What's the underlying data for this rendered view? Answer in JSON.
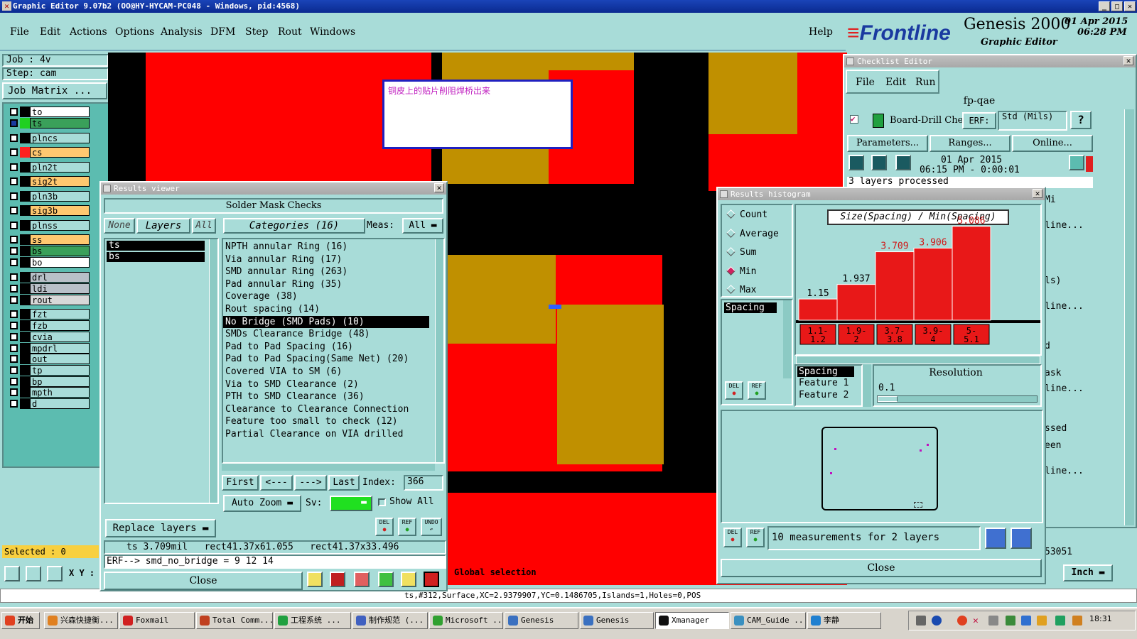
{
  "window": {
    "title": "Graphic Editor 9.07b2 (OO@HY-HYCAM-PC048 - Windows, pid:4568)"
  },
  "menu": {
    "file": "File",
    "edit": "Edit",
    "actions": "Actions",
    "options": "Options",
    "analysis": "Analysis",
    "dfm": "DFM",
    "step": "Step",
    "rout": "Rout",
    "windows": "Windows",
    "help": "Help"
  },
  "brand": {
    "logo": "Frontline",
    "product": "Genesis 2000",
    "sub": "Graphic Editor",
    "date": "01 Apr 2015",
    "time": "06:28 PM"
  },
  "job": {
    "job": "Job : 4v",
    "step": "Step: cam",
    "matrix": "Job Matrix ..."
  },
  "layers": [
    {
      "name": "to",
      "color": "#ffffff"
    },
    {
      "name": "ts",
      "color": "#3aa05a"
    },
    {
      "name": "plncs",
      "color": "#a8dcd8"
    },
    {
      "name": "cs",
      "color": "#ffc870"
    },
    {
      "name": "pln2t",
      "color": "#a8dcd8"
    },
    {
      "name": "sig2t",
      "color": "#ffc870"
    },
    {
      "name": "pln3b",
      "color": "#a8dcd8"
    },
    {
      "name": "sig3b",
      "color": "#ffc870"
    },
    {
      "name": "plnss",
      "color": "#a8dcd8"
    },
    {
      "name": "ss",
      "color": "#ffc870"
    },
    {
      "name": "bs",
      "color": "#3aa05a"
    },
    {
      "name": "bo",
      "color": "#ffffff"
    },
    {
      "name": "drl",
      "color": "#b8c0c8"
    },
    {
      "name": "ldi",
      "color": "#b8c0c8"
    },
    {
      "name": "rout",
      "color": "#d8d8d8"
    },
    {
      "name": "fzt",
      "color": "#a8dcd8"
    },
    {
      "name": "fzb",
      "color": "#a8dcd8"
    },
    {
      "name": "cvia",
      "color": "#a8dcd8"
    },
    {
      "name": "mpdrl",
      "color": "#a8dcd8"
    },
    {
      "name": "out",
      "color": "#a8dcd8"
    },
    {
      "name": "tp",
      "color": "#a8dcd8"
    },
    {
      "name": "bp",
      "color": "#a8dcd8"
    },
    {
      "name": "mpth",
      "color": "#a8dcd8"
    },
    {
      "name": "d",
      "color": "#a8dcd8"
    }
  ],
  "selected": "Selected : 0",
  "xy_label": "X Y :",
  "note": "铜皮上的贴片削阻焊桥出来",
  "status_line": "ts,#312,Surface,XC=2.9379907,YC=0.1486705,Islands=1,Holes=0,POS",
  "global_selection": "Global selection",
  "units": "Inch",
  "results_viewer": {
    "title": "Results viewer",
    "header": "Solder Mask Checks",
    "none": "None",
    "layers": "Layers",
    "all": "All",
    "categories": "Categories (16)",
    "meas_label": "Meas:",
    "meas_value": "All",
    "layer_list": [
      "ts",
      "bs"
    ],
    "category_list": [
      "NPTH annular Ring (16)",
      "Via annular Ring (17)",
      "SMD annular Ring (263)",
      "Pad annular Ring (35)",
      "Coverage (38)",
      "Rout spacing (14)",
      "No Bridge (SMD Pads) (10)",
      "SMDs Clearance Bridge (48)",
      "Pad to Pad Spacing (16)",
      "Pad to Pad Spacing(Same Net) (20)",
      "Covered VIA to SM (6)",
      "Via to SMD Clearance (2)",
      "PTH to SMD Clearance (36)",
      "Clearance to Clearance Connection",
      "Feature too small to check (12)",
      "Partial Clearance on VIA drilled"
    ],
    "selected_index": 6,
    "first": "First",
    "prev": "<---",
    "next": "--->",
    "last": "Last",
    "index_label": "Index:",
    "index_value": "366",
    "auto_zoom": "Auto Zoom",
    "sv": "Sv:",
    "show_all": "Show All",
    "replace_layers": "Replace layers",
    "del": "DEL",
    "ref": "REF",
    "undo": "UNDO",
    "info1": "ts 3.709mil   rect41.37x61.055   rect41.37x33.496",
    "erf": "ERF--> smd_no_bridge = 9 12 14",
    "close": "Close"
  },
  "histogram": {
    "title": "Results histogram",
    "modes": [
      "Count",
      "Average",
      "Sum",
      "Min",
      "Max"
    ],
    "selected_mode": "Min",
    "list_item": "Spacing",
    "chart_title": "Size(Spacing) / Min(Spacing)",
    "resolution_label": "Resolution",
    "resolution_value": "0.1",
    "measure_list": [
      "Spacing",
      "Feature 1",
      "Feature 2"
    ],
    "del": "DEL",
    "ref": "REF",
    "footer": "10 measurements for 2 layers",
    "close": "Close"
  },
  "chart_data": {
    "type": "bar",
    "title": "Size(Spacing) / Min(Spacing)",
    "categories": [
      "1.1-1.2",
      "1.9-2",
      "3.7-3.8",
      "3.9-4",
      "5-5.1"
    ],
    "values": [
      1.15,
      1.937,
      3.709,
      3.906,
      5.086
    ],
    "value_labels": [
      "1.15",
      "1.937",
      "3.709",
      "3.906",
      "5.086"
    ],
    "label_colors": [
      "#000000",
      "#000000",
      "#d01818",
      "#d01818",
      "#d01818"
    ],
    "ylim": [
      0,
      5.5
    ],
    "bar_color": "#e81818"
  },
  "checklist": {
    "title": "Checklist Editor",
    "menu": [
      "File",
      "Edit",
      "Run"
    ],
    "name": "fp-qae",
    "action": "Board-Drill Che",
    "erf": "ERF:",
    "erf_value": "Std (Mils)",
    "parameters": "Parameters...",
    "ranges": "Ranges...",
    "online": "Online...",
    "date": "01 Apr 2015",
    "time": "06:15 PM - 0:00:01",
    "processed": "3 layers processed",
    "side_frags": [
      "Mi",
      "line...",
      "ls)",
      "line...",
      "d",
      "ask",
      "line...",
      "ssed",
      "een",
      "line...",
      "53051"
    ]
  },
  "taskbar": {
    "start": "开始",
    "items": [
      "兴森快捷衡...",
      "Foxmail",
      "Total Comm...",
      "工程系统 ...",
      "制作规范 (...",
      "Microsoft ...",
      "Genesis",
      "Genesis",
      "Xmanager",
      "CAM_Guide ...",
      "李静"
    ],
    "clock": "18:31"
  }
}
